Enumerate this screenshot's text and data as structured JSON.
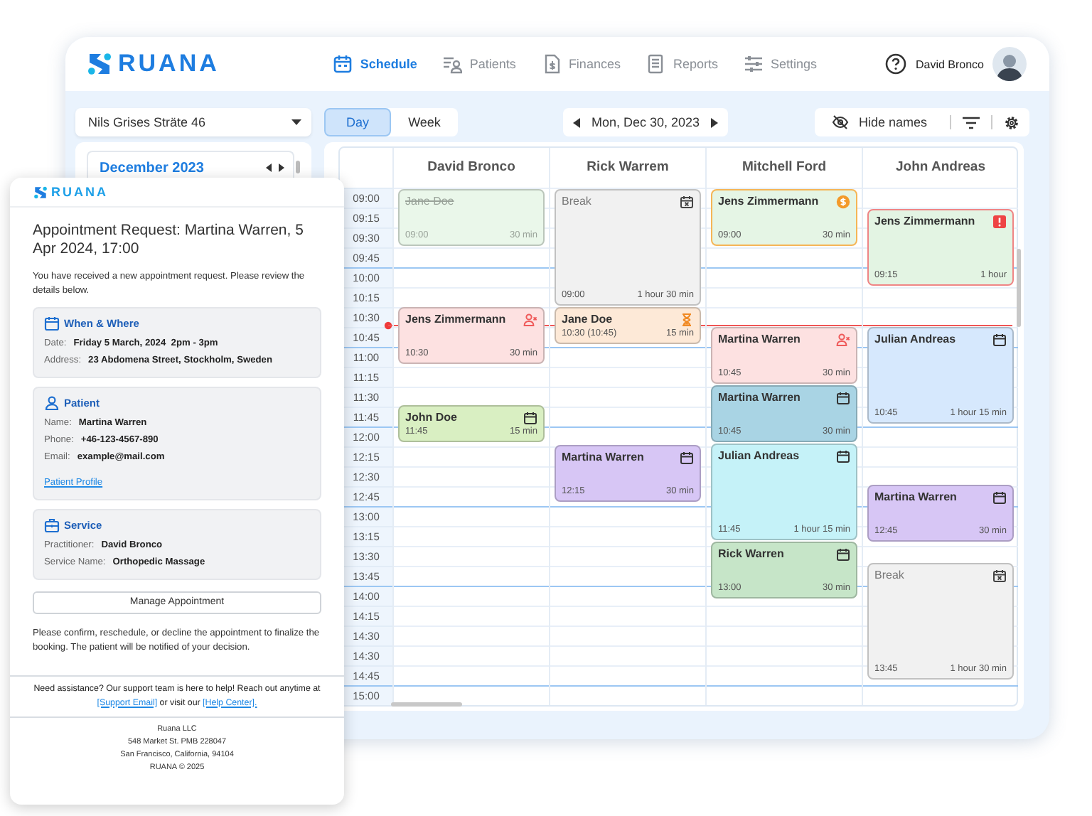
{
  "app": {
    "logo": "RUANA",
    "nav": [
      {
        "label": "Schedule",
        "kind": "schedule",
        "selected": true
      },
      {
        "label": "Patients",
        "kind": "patients",
        "selected": false
      },
      {
        "label": "Finances",
        "kind": "finances",
        "selected": false
      },
      {
        "label": "Reports",
        "kind": "reports",
        "selected": false
      },
      {
        "label": "Settings",
        "kind": "settings",
        "selected": false
      }
    ],
    "user": "David Bronco"
  },
  "toolbar": {
    "location": "Nils Grises Sträte 46",
    "views": [
      {
        "label": "Day",
        "selected": true
      },
      {
        "label": "Week",
        "selected": false
      }
    ],
    "date": "Mon, Dec 30, 2023",
    "hide_names": "Hide names"
  },
  "mini_calendar": {
    "month": "December 2023"
  },
  "schedule": {
    "times": [
      "09:00",
      "09:15",
      "09:30",
      "09:45",
      "10:00",
      "10:15",
      "10:30",
      "10:45",
      "11:00",
      "11:15",
      "11:30",
      "11:45",
      "12:00",
      "12:15",
      "12:30",
      "12:45",
      "13:00",
      "13:15",
      "13:30",
      "13:45",
      "14:00",
      "14:15",
      "14:30",
      "14:30",
      "14:45",
      "15:00"
    ],
    "columns": [
      {
        "name": "David Bronco",
        "events": [
          {
            "name": "Jane Doe",
            "start": "09:00",
            "duration": "30 min",
            "kind": "past",
            "color": "#eaf7ea"
          },
          {
            "name": "Jens Zimmermann",
            "start": "10:30",
            "duration": "30 min",
            "kind": "cancelled",
            "color": "#fde1e1"
          },
          {
            "name": "John Doe",
            "start": "11:45",
            "duration": "15 min",
            "kind": "booked",
            "color": "#d9efc2"
          }
        ]
      },
      {
        "name": "Rick Warrem",
        "events": [
          {
            "name": "Break",
            "start": "09:00",
            "duration": "1 hour 30 min",
            "kind": "break",
            "color": "#f1f1f1"
          },
          {
            "name": "Jane Doe",
            "start": "10:30 (10:45)",
            "duration": "15 min",
            "kind": "waiting",
            "color": "#fde9d7"
          },
          {
            "name": "Martina Warren",
            "start": "12:15",
            "duration": "30 min",
            "kind": "booked",
            "color": "#d7c6f5"
          }
        ]
      },
      {
        "name": "Mitchell Ford",
        "events": [
          {
            "name": "Jens Zimmermann",
            "start": "09:00",
            "duration": "30 min",
            "kind": "payment",
            "color": "#e5f5e5"
          },
          {
            "name": "Martina Warren",
            "start": "10:45",
            "duration": "30 min",
            "kind": "cancelled",
            "color": "#fde1e1"
          },
          {
            "name": "Martina Warren",
            "start": "10:45",
            "duration": "30 min",
            "kind": "booked",
            "color": "#a9d4e4"
          },
          {
            "name": "Julian Andreas",
            "start": "11:45",
            "duration": "1 hour 15 min",
            "kind": "booked",
            "color": "#c5f2f8"
          },
          {
            "name": "Rick Warren",
            "start": "13:00",
            "duration": "30 min",
            "kind": "booked",
            "color": "#c6e5c8"
          }
        ]
      },
      {
        "name": "John Andreas",
        "events": [
          {
            "name": "Jens Zimmermann",
            "start": "09:15",
            "duration": "1 hour",
            "kind": "alert",
            "color": "#e3f4e3"
          },
          {
            "name": "Julian Andreas",
            "start": "10:45",
            "duration": "1 hour 15 min",
            "kind": "booked",
            "color": "#d6e8fd"
          },
          {
            "name": "Martina Warren",
            "start": "12:45",
            "duration": "30 min",
            "kind": "booked",
            "color": "#d7c6f5"
          },
          {
            "name": "Break",
            "start": "13:45",
            "duration": "1 hour 30 min",
            "kind": "break",
            "color": "#f1f1f1"
          }
        ]
      }
    ]
  },
  "email": {
    "logo": "RUANA",
    "title": "Appointment Request: Martina Warren, 5 Apr 2024, 17:00",
    "intro": "You have received a new appointment request. Please review the details below.",
    "sections": [
      {
        "kind": "when",
        "title": "When & Where",
        "fields": [
          {
            "label": "Date:",
            "value": "Friday 5 March, 2024  2pm - 3pm"
          },
          {
            "label": "Address:",
            "value": "23 Abdomena Street, Stockholm, Sweden"
          }
        ]
      },
      {
        "kind": "patient",
        "title": "Patient",
        "fields": [
          {
            "label": "Name:",
            "value": "Martina Warren"
          },
          {
            "label": "Phone:",
            "value": "+46-123-4567-890"
          },
          {
            "label": "Email:",
            "value": "example@mail.com"
          }
        ],
        "link": "Patient Profile"
      },
      {
        "kind": "service",
        "title": "Service",
        "fields": [
          {
            "label": "Practitioner:",
            "value": "David Bronco"
          },
          {
            "label": "Service Name:",
            "value": "Orthopedic Massage"
          }
        ]
      }
    ],
    "button": "Manage Appointment",
    "note": "Please confirm, reschedule, or decline the appointment to finalize the booking. The patient will be notified of your decision.",
    "support": {
      "text": "Need assistance? Our support team is here to help! Reach out anytime at",
      "link_1": "[Support Email]",
      "middle": "or visit our",
      "link_2": "[Help Center]."
    },
    "footer": [
      "Ruana LLC",
      "548 Market St. PMB 228047",
      "San Francisco, California, 94104",
      "RUANA © 2025"
    ]
  }
}
